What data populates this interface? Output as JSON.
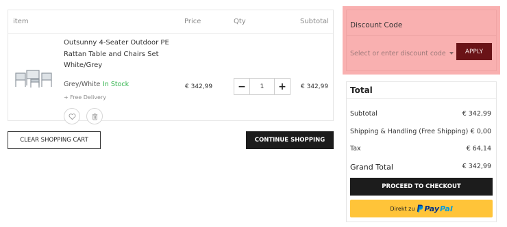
{
  "cart": {
    "headers": {
      "item": "item",
      "price": "Price",
      "qty": "Qty",
      "subtotal": "Subtotal"
    },
    "items": [
      {
        "name": "Outsunny 4-Seater Outdoor PE Rattan Table and Chairs Set White/Grey",
        "variant": "Grey/White",
        "stock": "In Stock",
        "delivery": "+ Free Delivery",
        "price": "€ 342,99",
        "quantity": "1",
        "subtotal": "€ 342,99",
        "minus_label": "−",
        "plus_label": "+",
        "thumbnail_icon": "patio-furniture-image",
        "wishlist_icon": "heart-icon",
        "remove_icon": "trash-icon"
      }
    ],
    "clear_button": "CLEAR SHOPPING CART",
    "continue_button": "CONTINUE SHOPPING"
  },
  "discount": {
    "title": "Discount Code",
    "select_value": "Select or enter discount code",
    "apply_button": "APPLY"
  },
  "totals": {
    "title": "Total",
    "rows": [
      {
        "label": "Subtotal",
        "value": "€ 342,99"
      },
      {
        "label": "Shipping & Handling (Free Shipping)",
        "value": "€ 0,00"
      },
      {
        "label": "Tax",
        "value": "€ 64,14"
      },
      {
        "label": "Grand Total",
        "value": "€ 342,99"
      }
    ],
    "checkout_button": "PROCEED TO CHECKOUT",
    "paypal": {
      "prefix": "Direkt zu",
      "pay": "Pay",
      "pal": "Pal"
    }
  },
  "colors": {
    "accent_dark": "#1c1c1c",
    "in_stock": "#2fb34a",
    "discount_highlight": "#f9b0b0",
    "apply_button": "#6a1317",
    "paypal_yellow": "#ffc439"
  }
}
